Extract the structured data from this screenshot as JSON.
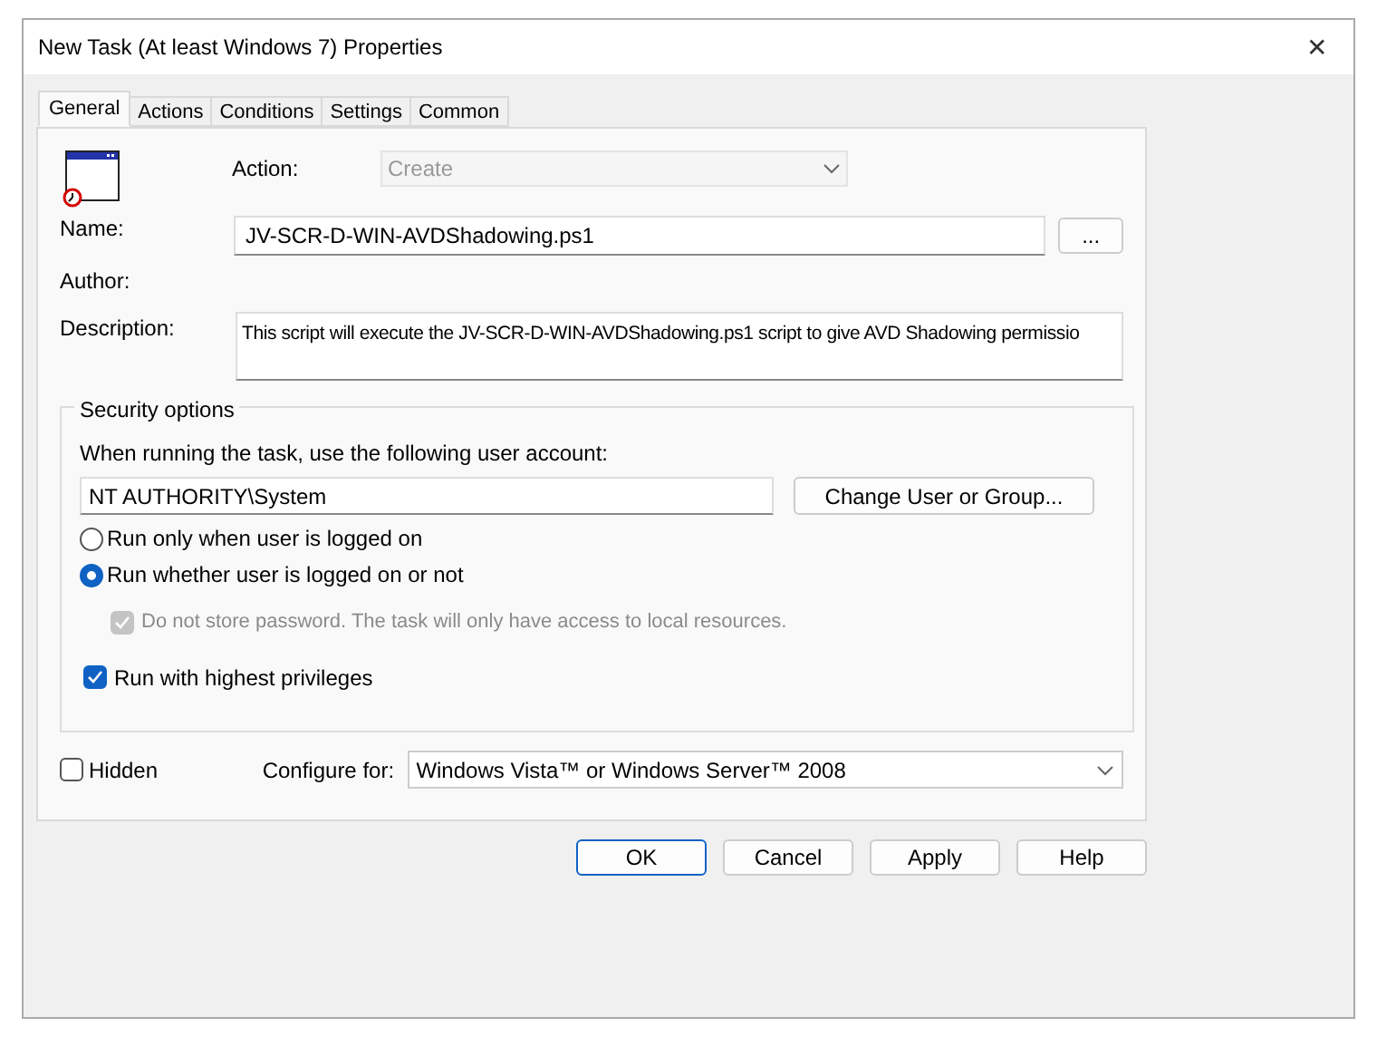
{
  "window": {
    "title": "New Task (At least Windows 7) Properties",
    "close": "✕"
  },
  "tabs": [
    {
      "label": "General",
      "selected": true
    },
    {
      "label": "Actions",
      "selected": false
    },
    {
      "label": "Conditions",
      "selected": false
    },
    {
      "label": "Settings",
      "selected": false
    },
    {
      "label": "Common",
      "selected": false
    }
  ],
  "general": {
    "action": {
      "label": "Action:",
      "value": "Create",
      "disabled": true
    },
    "name": {
      "label": "Name:",
      "value": "JV-SCR-D-WIN-AVDShadowing.ps1"
    },
    "browse_button": "...",
    "author": {
      "label": "Author:"
    },
    "description": {
      "label": "Description:",
      "value": "This script will execute the JV-SCR-D-WIN-AVDShadowing.ps1 script to give AVD Shadowing permissio"
    }
  },
  "security_options": {
    "title": "Security options",
    "account_prompt": "When running the task, use the following user account:",
    "account": "NT AUTHORITY\\System",
    "change_button": "Change User or Group...",
    "radios": [
      {
        "label": "Run only when user is logged on",
        "selected": false
      },
      {
        "label": "Run whether user is logged on or not",
        "selected": true
      }
    ],
    "do_not_store": {
      "label": "Do not store password. The task will only have access to local resources.",
      "checked": true,
      "disabled": true
    },
    "highest": {
      "label": "Run with highest privileges",
      "checked": true
    }
  },
  "hidden": {
    "label": "Hidden",
    "checked": false
  },
  "configure_for": {
    "label": "Configure for:",
    "value": "Windows Vista™ or Windows Server™ 2008"
  },
  "buttons": [
    {
      "label": "OK",
      "default": true
    },
    {
      "label": "Cancel",
      "default": false
    },
    {
      "label": "Apply",
      "default": false
    },
    {
      "label": "Help",
      "default": false
    }
  ]
}
